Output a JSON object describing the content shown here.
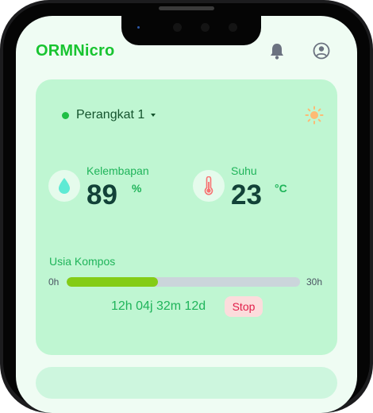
{
  "app": {
    "title": "ORMNicro"
  },
  "header": {
    "notification_icon": "bell-icon",
    "profile_icon": "user-circle-icon"
  },
  "device": {
    "name": "Perangkat 1",
    "status": "online",
    "status_color": "#1fbf45",
    "weather_icon": "sun-icon"
  },
  "metrics": {
    "humidity": {
      "label": "Kelembapan",
      "value": "89",
      "unit": "%",
      "icon": "water-drop-icon"
    },
    "temperature": {
      "label": "Suhu",
      "value": "23",
      "unit": "°C",
      "icon": "thermometer-icon"
    }
  },
  "compost_age": {
    "label": "Usia Kompos",
    "min_label": "0h",
    "max_label": "30h",
    "progress_fraction": 0.39,
    "timer": "12h 04j 32m 12d",
    "stop_label": "Stop"
  },
  "colors": {
    "accent": "#18c430",
    "card_bg": "#bff6d2",
    "progress": "#84cc16",
    "stop": "#e11d48"
  }
}
